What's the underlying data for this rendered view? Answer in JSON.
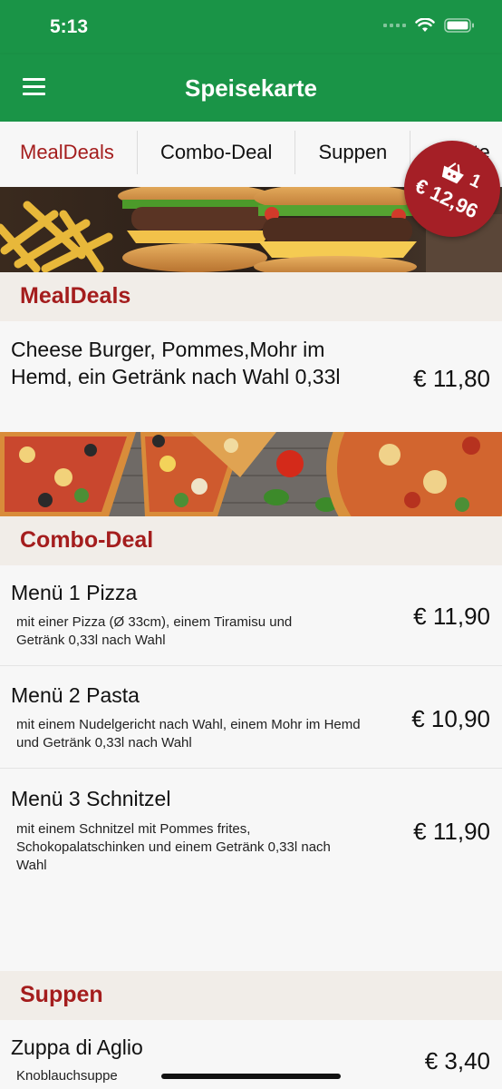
{
  "status": {
    "time": "5:13"
  },
  "appbar": {
    "title": "Speisekarte"
  },
  "tabs": [
    {
      "label": "MealDeals"
    },
    {
      "label": "Combo-Deal"
    },
    {
      "label": "Suppen"
    },
    {
      "label": "Salate"
    }
  ],
  "cart": {
    "count": "1",
    "total": "€ 12,96"
  },
  "sections": {
    "mealdeals": {
      "title": "MealDeals",
      "items": [
        {
          "name": "Cheese Burger, Pommes,Mohr im Hemd, ein Getränk nach Wahl 0,33l",
          "price": "€ 11,80"
        }
      ]
    },
    "combo": {
      "title": "Combo-Deal",
      "items": [
        {
          "name": "Menü 1 Pizza",
          "desc": "mit einer Pizza (Ø 33cm), einem Tiramisu und Getränk 0,33l nach Wahl",
          "price": "€ 11,90"
        },
        {
          "name": "Menü 2 Pasta",
          "desc": "mit einem Nudelgericht nach Wahl, einem Mohr im Hemd und Getränk 0,33l nach Wahl",
          "price": "€ 10,90"
        },
        {
          "name": "Menü 3 Schnitzel",
          "desc": "mit einem Schnitzel mit Pommes frites, Schokopalatschinken und einem Getränk 0,33l nach Wahl",
          "price": "€ 11,90"
        }
      ]
    },
    "suppen": {
      "title": "Suppen",
      "items": [
        {
          "name": "Zuppa di Aglio",
          "desc": "Knoblauchsuppe",
          "price": "€ 3,40"
        }
      ]
    }
  },
  "colors": {
    "primary": "#1a9447",
    "accent": "#a41d1d",
    "cart": "#a51f26"
  }
}
